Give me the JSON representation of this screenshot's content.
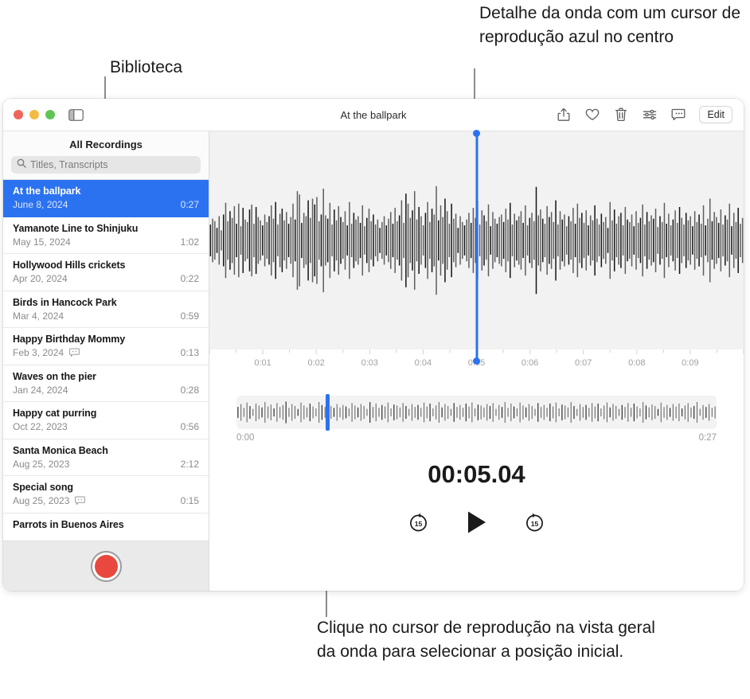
{
  "callouts": {
    "library": "Biblioteca",
    "waveform_detail": "Detalhe da onda com um cursor de reprodução azul no centro",
    "playhead_hint": "Clique no cursor de reprodução na vista geral da onda para selecionar a posição inicial."
  },
  "window": {
    "title": "At the ballpark",
    "traffic_lights": [
      "close",
      "minimize",
      "zoom"
    ],
    "sidebar_toggle_icon": "sidebar-toggle-icon",
    "toolbar": {
      "share_icon": "share-icon",
      "favorite_icon": "heart-icon",
      "delete_icon": "trash-icon",
      "enhance_icon": "sliders-icon",
      "transcript_icon": "transcript-icon",
      "edit_label": "Edit"
    }
  },
  "sidebar": {
    "header": "All Recordings",
    "search": {
      "placeholder": "Titles, Transcripts",
      "value": "",
      "icon": "search-icon"
    },
    "recordings": [
      {
        "title": "At the ballpark",
        "date": "June 8, 2024",
        "duration": "0:27",
        "selected": true,
        "transcript": false
      },
      {
        "title": "Yamanote Line to Shinjuku",
        "date": "May 15, 2024",
        "duration": "1:02",
        "selected": false,
        "transcript": false
      },
      {
        "title": "Hollywood Hills crickets",
        "date": "Apr 20, 2024",
        "duration": "0:22",
        "selected": false,
        "transcript": false
      },
      {
        "title": "Birds in Hancock Park",
        "date": "Mar 4, 2024",
        "duration": "0:59",
        "selected": false,
        "transcript": false
      },
      {
        "title": "Happy Birthday Mommy",
        "date": "Feb 3, 2024",
        "duration": "0:13",
        "selected": false,
        "transcript": true
      },
      {
        "title": "Waves on the pier",
        "date": "Jan 24, 2024",
        "duration": "0:28",
        "selected": false,
        "transcript": false
      },
      {
        "title": "Happy cat purring",
        "date": "Oct 22, 2023",
        "duration": "0:56",
        "selected": false,
        "transcript": false
      },
      {
        "title": "Santa Monica Beach",
        "date": "Aug 25, 2023",
        "duration": "2:12",
        "selected": false,
        "transcript": false
      },
      {
        "title": "Special song",
        "date": "Aug 25, 2023",
        "duration": "0:15",
        "selected": false,
        "transcript": true
      },
      {
        "title": "Parrots in Buenos Aires",
        "date": "",
        "duration": "",
        "selected": false,
        "transcript": false
      }
    ],
    "record_button": "record-button"
  },
  "player": {
    "timecode": "00:05.04",
    "ruler_ticks": [
      "0:01",
      "0:02",
      "0:03",
      "0:04",
      "0:05",
      "0:06",
      "0:07",
      "0:08",
      "0:09"
    ],
    "overview_start": "0:00",
    "overview_end": "0:27",
    "playhead_position_percent": 18.5,
    "controls": {
      "skip_back_label": "15",
      "play_label": "play",
      "skip_forward_label": "15"
    }
  },
  "colors": {
    "accent_blue": "#2b72f0",
    "record_red": "#e8483d",
    "waveform_dark": "#2a2a2a",
    "waveform_bg": "#f2f2f2"
  },
  "waveform_detail_bars": [
    38,
    52,
    46,
    30,
    58,
    24,
    62,
    90,
    46,
    70,
    54,
    82,
    40,
    88,
    34,
    78,
    50,
    44,
    74,
    86,
    40,
    80,
    56,
    48,
    36,
    62,
    44,
    58,
    84,
    52,
    92,
    38,
    64,
    76,
    48,
    68,
    40,
    56,
    88,
    50,
    118,
    110,
    42,
    66,
    58,
    96,
    54,
    100,
    86,
    104,
    46,
    62,
    124,
    60,
    52,
    90,
    38,
    74,
    48,
    82,
    56,
    44,
    70,
    36,
    92,
    40,
    66,
    50,
    58,
    42,
    84,
    34,
    54,
    76,
    46,
    62,
    38,
    50,
    30,
    44,
    58,
    36,
    52,
    68,
    40,
    78,
    46,
    60,
    96,
    42,
    112,
    88,
    54,
    72,
    118,
    50,
    80,
    58,
    36,
    66,
    92,
    44,
    76,
    62,
    130,
    48,
    84,
    56,
    100,
    70,
    40,
    88,
    52,
    64,
    30,
    58,
    44,
    36,
    50,
    66,
    42,
    78,
    54,
    94,
    38,
    72,
    60,
    46,
    86,
    34,
    68,
    52,
    40,
    56,
    62,
    44,
    76,
    50,
    90,
    38,
    64,
    48,
    58,
    70,
    42,
    84,
    36,
    54,
    66,
    46,
    128,
    60,
    74,
    52,
    40,
    82,
    56,
    68,
    44,
    96,
    38,
    70,
    50,
    62,
    34,
    58,
    46,
    78,
    40,
    88,
    54,
    66,
    42,
    72,
    36,
    60,
    48,
    84,
    52,
    38,
    64,
    44,
    56,
    30,
    92,
    48,
    74,
    40,
    58,
    66,
    36,
    80,
    50,
    44,
    62,
    34,
    70,
    42,
    54,
    86,
    38,
    68,
    46,
    60,
    52,
    76,
    32,
    58,
    44,
    90,
    40,
    64,
    36,
    50,
    72,
    42,
    80,
    54,
    38,
    66,
    48,
    58,
    34,
    70,
    44,
    62,
    40,
    84,
    36,
    52,
    100,
    46,
    68,
    56,
    42,
    74,
    38,
    60,
    50,
    88,
    34,
    66,
    44,
    78,
    40,
    54
  ],
  "waveform_overview_bars": [
    22,
    34,
    18,
    40,
    26,
    14,
    36,
    28,
    20,
    42,
    24,
    32,
    16,
    38,
    22,
    30,
    44,
    18,
    34,
    26,
    14,
    40,
    28,
    20,
    36,
    24,
    16,
    42,
    30,
    22,
    38,
    26,
    18,
    34,
    20,
    30,
    24,
    16,
    38,
    28,
    20,
    34,
    26,
    14,
    42,
    22,
    36,
    18,
    30,
    24,
    40,
    16,
    32,
    28,
    20,
    38,
    26,
    14,
    34,
    22,
    30,
    18,
    40,
    24,
    36,
    16,
    28,
    42,
    20,
    34,
    26,
    14,
    38,
    22,
    30,
    18,
    36,
    24,
    40,
    16,
    32,
    28,
    20,
    34,
    26,
    38,
    14,
    30,
    22,
    42,
    18,
    36,
    24,
    16,
    40,
    28,
    20,
    34,
    26,
    14,
    38,
    22,
    30,
    18,
    36,
    24,
    40,
    16,
    32,
    28,
    20,
    42,
    26,
    14,
    34,
    22,
    30,
    18,
    38,
    24,
    36,
    16,
    28,
    40,
    20,
    34,
    26,
    14,
    30,
    22,
    38,
    18,
    36,
    24,
    16,
    42,
    28,
    20,
    32,
    26,
    14,
    40,
    22,
    30,
    18,
    34,
    24,
    36,
    16,
    28,
    38,
    20,
    26,
    42,
    14,
    30,
    22,
    34,
    18,
    24
  ]
}
